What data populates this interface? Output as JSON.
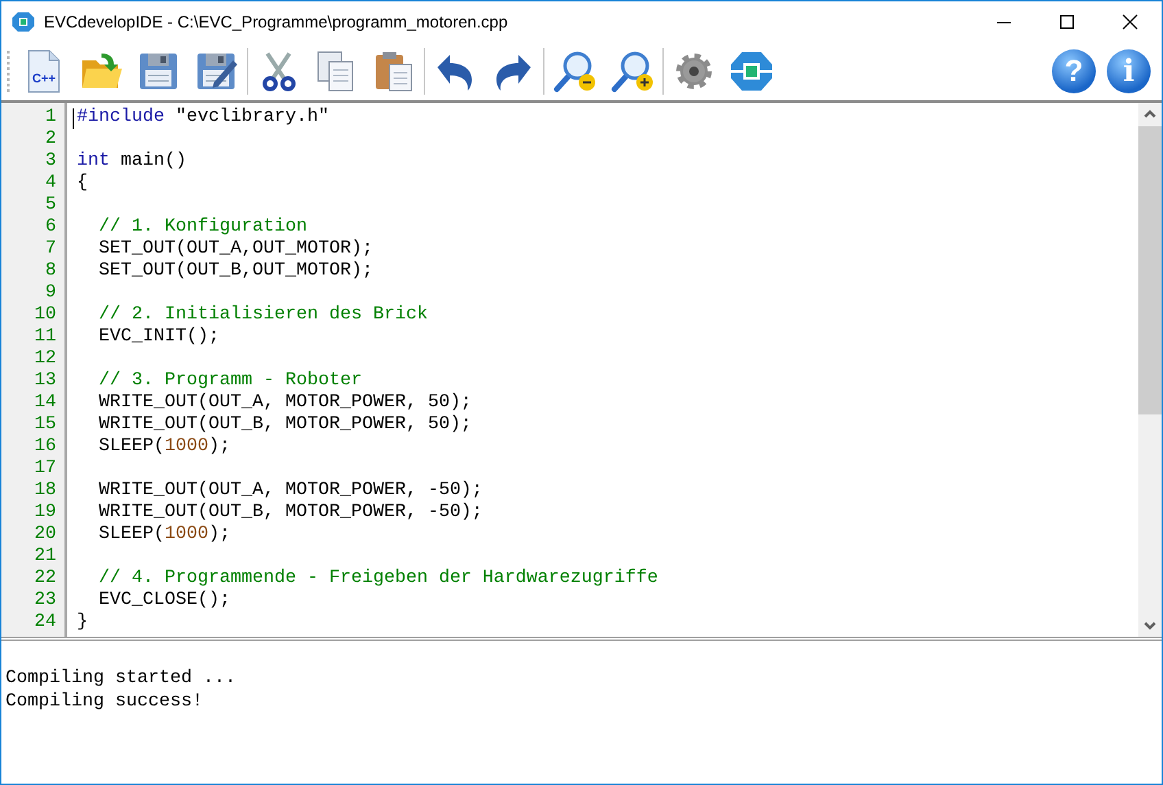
{
  "window": {
    "title": "EVCdevelopIDE - C:\\EVC_Programme\\programm_motoren.cpp"
  },
  "toolbar": {
    "groups": [
      [
        {
          "kind": "new_cpp",
          "label": "C++"
        },
        {
          "kind": "open"
        },
        {
          "kind": "save"
        },
        {
          "kind": "save_as"
        }
      ],
      [
        {
          "kind": "cut"
        },
        {
          "kind": "copy"
        },
        {
          "kind": "paste"
        }
      ],
      [
        {
          "kind": "undo"
        },
        {
          "kind": "redo"
        }
      ],
      [
        {
          "kind": "zoom_out"
        },
        {
          "kind": "zoom_in"
        }
      ],
      [
        {
          "kind": "settings"
        },
        {
          "kind": "module"
        }
      ]
    ],
    "right": [
      {
        "kind": "help",
        "label": "?"
      },
      {
        "kind": "info",
        "label": "i"
      }
    ]
  },
  "editor": {
    "lines": [
      {
        "number": "1",
        "tokens": [
          {
            "kind": "keyword",
            "text": "#include"
          },
          {
            "kind": "plain",
            "text": " \"evclibrary.h\""
          }
        ]
      },
      {
        "number": "2"
      },
      {
        "number": "3",
        "tokens": [
          {
            "kind": "keyword",
            "text": "int"
          },
          {
            "kind": "plain",
            "text": " main()"
          }
        ]
      },
      {
        "number": "4",
        "tokens": [
          {
            "kind": "plain",
            "text": "{"
          }
        ]
      },
      {
        "number": "5"
      },
      {
        "number": "6",
        "tokens": [
          {
            "kind": "comment",
            "text": "  // 1. Konfiguration"
          }
        ]
      },
      {
        "number": "7",
        "tokens": [
          {
            "kind": "plain",
            "text": "  SET_OUT(OUT_A,OUT_MOTOR);"
          }
        ]
      },
      {
        "number": "8",
        "tokens": [
          {
            "kind": "plain",
            "text": "  SET_OUT(OUT_B,OUT_MOTOR);"
          }
        ]
      },
      {
        "number": "9"
      },
      {
        "number": "10",
        "tokens": [
          {
            "kind": "comment",
            "text": "  // 2. Initialisieren des Brick"
          }
        ]
      },
      {
        "number": "11",
        "tokens": [
          {
            "kind": "plain",
            "text": "  EVC_INIT();"
          }
        ]
      },
      {
        "number": "12"
      },
      {
        "number": "13",
        "tokens": [
          {
            "kind": "comment",
            "text": "  // 3. Programm - Roboter"
          }
        ]
      },
      {
        "number": "14",
        "tokens": [
          {
            "kind": "plain",
            "text": "  WRITE_OUT(OUT_A, MOTOR_POWER, 50);"
          }
        ]
      },
      {
        "number": "15",
        "tokens": [
          {
            "kind": "plain",
            "text": "  WRITE_OUT(OUT_B, MOTOR_POWER, 50);"
          }
        ]
      },
      {
        "number": "16",
        "tokens": [
          {
            "kind": "plain",
            "text": "  SLEEP("
          },
          {
            "kind": "number",
            "text": "1000"
          },
          {
            "kind": "plain",
            "text": ");"
          }
        ]
      },
      {
        "number": "17"
      },
      {
        "number": "18",
        "tokens": [
          {
            "kind": "plain",
            "text": "  WRITE_OUT(OUT_A, MOTOR_POWER, -50);"
          }
        ]
      },
      {
        "number": "19",
        "tokens": [
          {
            "kind": "plain",
            "text": "  WRITE_OUT(OUT_B, MOTOR_POWER, -50);"
          }
        ]
      },
      {
        "number": "20",
        "tokens": [
          {
            "kind": "plain",
            "text": "  SLEEP("
          },
          {
            "kind": "number",
            "text": "1000"
          },
          {
            "kind": "plain",
            "text": ");"
          }
        ]
      },
      {
        "number": "21"
      },
      {
        "number": "22",
        "tokens": [
          {
            "kind": "comment",
            "text": "  // 4. Programmende - Freigeben der Hardwarezugriffe"
          }
        ]
      },
      {
        "number": "23",
        "tokens": [
          {
            "kind": "plain",
            "text": "  EVC_CLOSE();"
          }
        ]
      },
      {
        "number": "24",
        "tokens": [
          {
            "kind": "plain",
            "text": "}"
          }
        ]
      }
    ]
  },
  "output": {
    "lines": [
      "Compiling started ...",
      "Compiling success!"
    ]
  }
}
